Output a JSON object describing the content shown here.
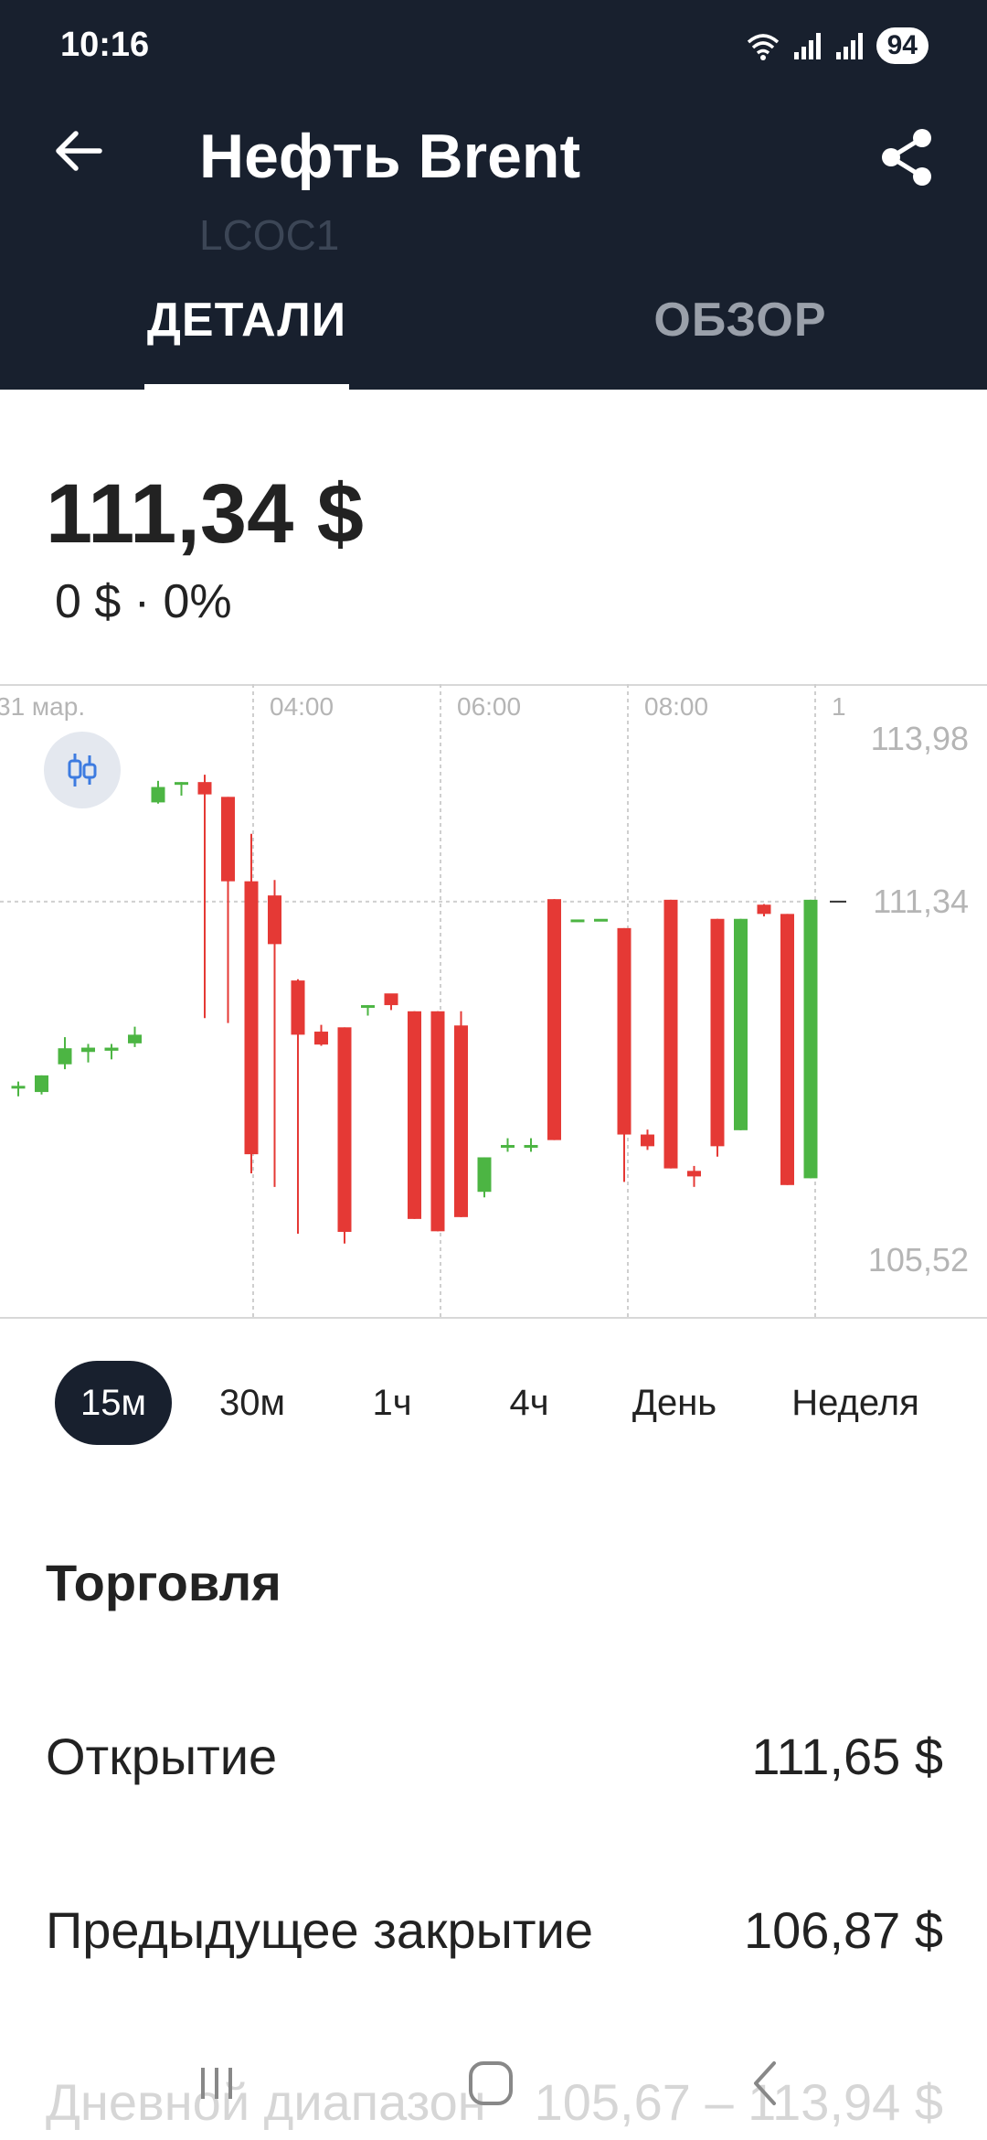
{
  "status": {
    "time": "10:16",
    "battery": "94"
  },
  "header": {
    "title": "Нефть Brent",
    "ticker": "LCOC1"
  },
  "tabs": [
    {
      "label": "ДЕТАЛИ"
    },
    {
      "label": "ОБЗОР"
    }
  ],
  "quote": {
    "price": "111,34 $",
    "change": "0 $ · 0%"
  },
  "colors": {
    "header_bg": "#18202e",
    "up": "#4cb543",
    "down": "#e53935"
  },
  "chart_data": {
    "type": "candlestick",
    "x_ticks": [
      "31 мар.",
      "04:00",
      "06:00",
      "08:00",
      "1"
    ],
    "y_ticks": [
      "113,98",
      "111,34",
      "105,52"
    ],
    "y_range": [
      105.52,
      113.98
    ],
    "current_price_line": 111.34,
    "candles": [
      {
        "o": 108.35,
        "h": 108.42,
        "l": 108.18,
        "c": 108.35
      },
      {
        "o": 108.25,
        "h": 108.52,
        "l": 108.21,
        "c": 108.52
      },
      {
        "o": 108.7,
        "h": 109.14,
        "l": 108.62,
        "c": 108.96
      },
      {
        "o": 108.9,
        "h": 109.03,
        "l": 108.73,
        "c": 108.97
      },
      {
        "o": 108.92,
        "h": 109.03,
        "l": 108.78,
        "c": 108.97
      },
      {
        "o": 109.04,
        "h": 109.31,
        "l": 108.98,
        "c": 109.18
      },
      {
        "o": 112.95,
        "h": 113.3,
        "l": 112.93,
        "c": 113.2
      },
      {
        "o": 113.27,
        "h": 113.28,
        "l": 113.06,
        "c": 113.28
      },
      {
        "o": 113.28,
        "h": 113.4,
        "l": 109.45,
        "c": 113.08
      },
      {
        "o": 113.04,
        "h": 113.04,
        "l": 109.37,
        "c": 111.67
      },
      {
        "o": 111.67,
        "h": 112.44,
        "l": 106.93,
        "c": 107.24
      },
      {
        "o": 111.44,
        "h": 111.69,
        "l": 106.71,
        "c": 110.65
      },
      {
        "o": 110.06,
        "h": 110.08,
        "l": 105.95,
        "c": 109.18
      },
      {
        "o": 109.23,
        "h": 109.34,
        "l": 109.0,
        "c": 109.02
      },
      {
        "o": 109.3,
        "h": 109.3,
        "l": 105.79,
        "c": 105.98
      },
      {
        "o": 109.66,
        "h": 109.66,
        "l": 109.49,
        "c": 109.66
      },
      {
        "o": 109.85,
        "h": 109.82,
        "l": 109.58,
        "c": 109.66
      },
      {
        "o": 109.56,
        "h": 109.56,
        "l": 106.19,
        "c": 106.19
      },
      {
        "o": 109.56,
        "h": 109.56,
        "l": 105.99,
        "c": 105.99
      },
      {
        "o": 109.33,
        "h": 109.56,
        "l": 106.22,
        "c": 106.22
      },
      {
        "o": 106.63,
        "h": 107.19,
        "l": 106.54,
        "c": 107.19
      },
      {
        "o": 107.39,
        "h": 107.5,
        "l": 107.28,
        "c": 107.39
      },
      {
        "o": 107.39,
        "h": 107.5,
        "l": 107.28,
        "c": 107.39
      },
      {
        "o": 111.38,
        "h": 111.38,
        "l": 107.47,
        "c": 107.47
      },
      {
        "o": 111.05,
        "h": 111.05,
        "l": 111.05,
        "c": 111.05
      },
      {
        "o": 111.06,
        "h": 111.06,
        "l": 111.06,
        "c": 111.06
      },
      {
        "o": 110.91,
        "h": 110.91,
        "l": 106.79,
        "c": 107.56
      },
      {
        "o": 107.56,
        "h": 107.64,
        "l": 107.31,
        "c": 107.37
      },
      {
        "o": 111.37,
        "h": 111.37,
        "l": 107.01,
        "c": 107.01
      },
      {
        "o": 106.97,
        "h": 107.05,
        "l": 106.71,
        "c": 106.88
      },
      {
        "o": 111.06,
        "h": 111.06,
        "l": 107.2,
        "c": 107.37
      },
      {
        "o": 107.63,
        "h": 111.06,
        "l": 107.63,
        "c": 111.06
      },
      {
        "o": 111.29,
        "h": 111.3,
        "l": 111.1,
        "c": 111.14
      },
      {
        "o": 111.14,
        "h": 111.14,
        "l": 106.74,
        "c": 106.74
      },
      {
        "o": 106.85,
        "h": 111.37,
        "l": 106.85,
        "c": 111.37
      }
    ]
  },
  "periods": [
    {
      "label": "15м",
      "active": true
    },
    {
      "label": "30м"
    },
    {
      "label": "1ч"
    },
    {
      "label": "4ч"
    },
    {
      "label": "День"
    },
    {
      "label": "Неделя"
    }
  ],
  "trading": {
    "title": "Торговля",
    "rows": [
      {
        "label": "Открытие",
        "value": "111,65 $"
      },
      {
        "label": "Предыдущее закрытие",
        "value": "106,87 $"
      },
      {
        "label": "Дневной диапазон",
        "value": "105,67 – 113,94 $"
      }
    ]
  }
}
